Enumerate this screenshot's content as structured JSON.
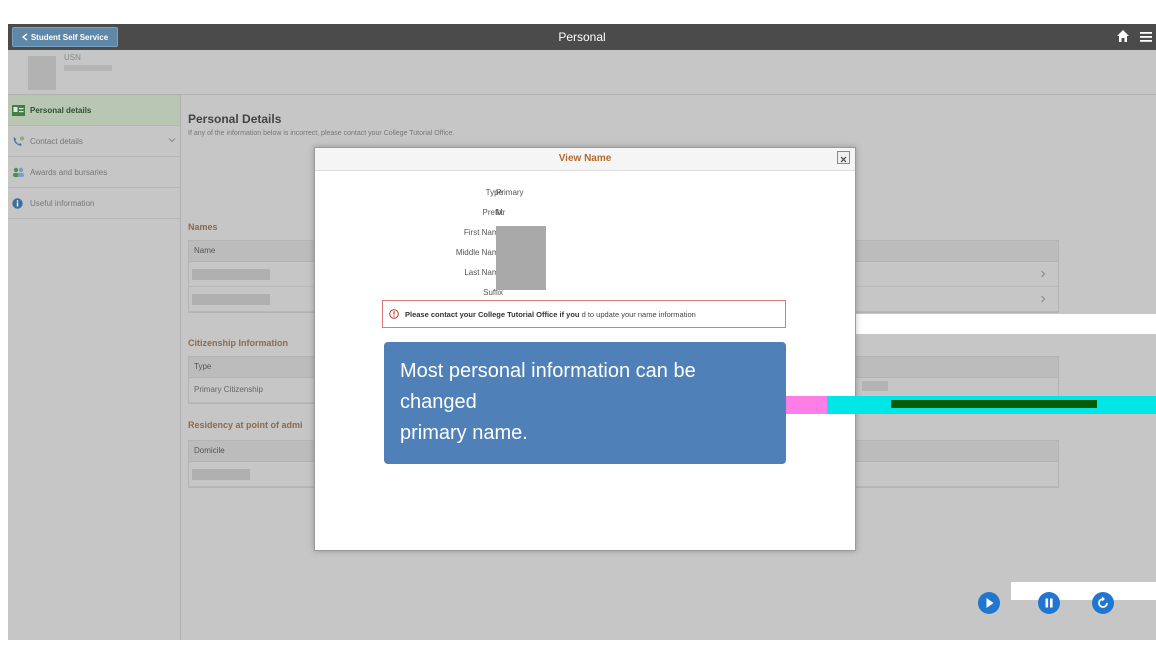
{
  "topbar": {
    "back_label": "Student Self Service",
    "title": "Personal"
  },
  "profile": {
    "id_label": "USN"
  },
  "sidebar": {
    "items": [
      {
        "label": "Personal details"
      },
      {
        "label": "Contact details"
      },
      {
        "label": "Awards and bursaries"
      },
      {
        "label": "Useful information"
      }
    ]
  },
  "page": {
    "title": "Personal Details",
    "subtitle": "If any of the information below is incorrect, please contact your College Tutorial Office."
  },
  "names": {
    "section_title": "Names",
    "column": "Name"
  },
  "citizenship": {
    "section_title": "Citizenship Information",
    "column": "Type",
    "row_value": "Primary Citizenship"
  },
  "residency": {
    "section_title": "Residency at point of admi",
    "column": "Domicile"
  },
  "modal": {
    "title": "View Name",
    "fields": [
      {
        "label": "Type",
        "value": "Primary"
      },
      {
        "label": "Prefix",
        "value": "Mr"
      },
      {
        "label": "First Name",
        "value": ""
      },
      {
        "label": "Middle Name",
        "value": ""
      },
      {
        "label": "Last Name",
        "value": ""
      },
      {
        "label": "Suffix",
        "value": ""
      }
    ],
    "alert_bold": "Please contact your College Tutorial Office if you",
    "alert_rest": "d to update your name information"
  },
  "callout": {
    "line1": "Most personal information  can be",
    "line2": "changed",
    "line3": "primary name."
  },
  "colors": {
    "topbar": "#4b4b4b",
    "modal_title": "#b36b2d",
    "section_title": "#8b6a4e",
    "callout": "#4f80b8",
    "player_button": "#2176cf"
  },
  "icons": [
    "home-icon",
    "menu-icon",
    "chevron-left-icon",
    "id-card-icon",
    "phone-icon",
    "people-icon",
    "info-icon",
    "close-icon",
    "alert-icon",
    "chevron-right-icon",
    "play-icon",
    "pause-icon",
    "replay-icon"
  ]
}
